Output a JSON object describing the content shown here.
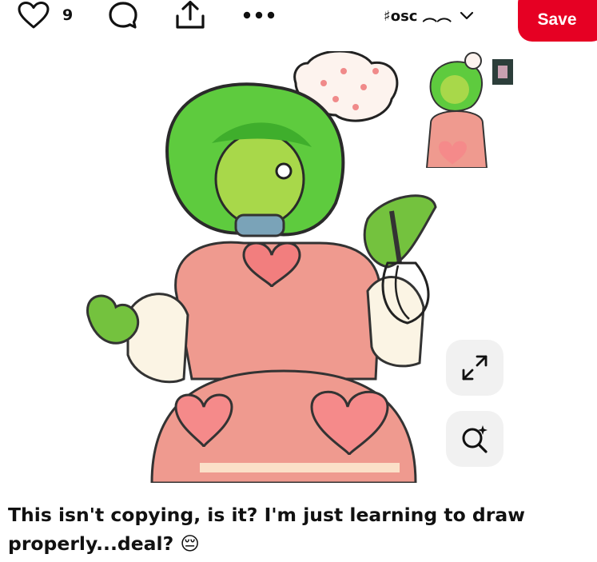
{
  "toolbar": {
    "like_icon": "heart-outline-icon",
    "like_count": "9",
    "comment_icon": "speech-bubble-icon",
    "share_icon": "share-upload-icon",
    "more_icon": "more-dots-icon",
    "board": {
      "name": "♯osc ︵︵",
      "chevron_icon": "chevron-down-icon"
    },
    "save_label": "Save"
  },
  "pin": {
    "image_description_icon": "illustration-image",
    "thumbnail_icon": "related-pin-thumbnail",
    "expand_icon": "expand-arrows-icon",
    "visual_search_icon": "visual-search-icon",
    "title": "This isn't copying, is it? I'm just learning to draw properly...deal? 😔"
  },
  "colors": {
    "accent": "#e60023",
    "text": "#111111",
    "floating_button_bg": "#f1f1f1"
  }
}
